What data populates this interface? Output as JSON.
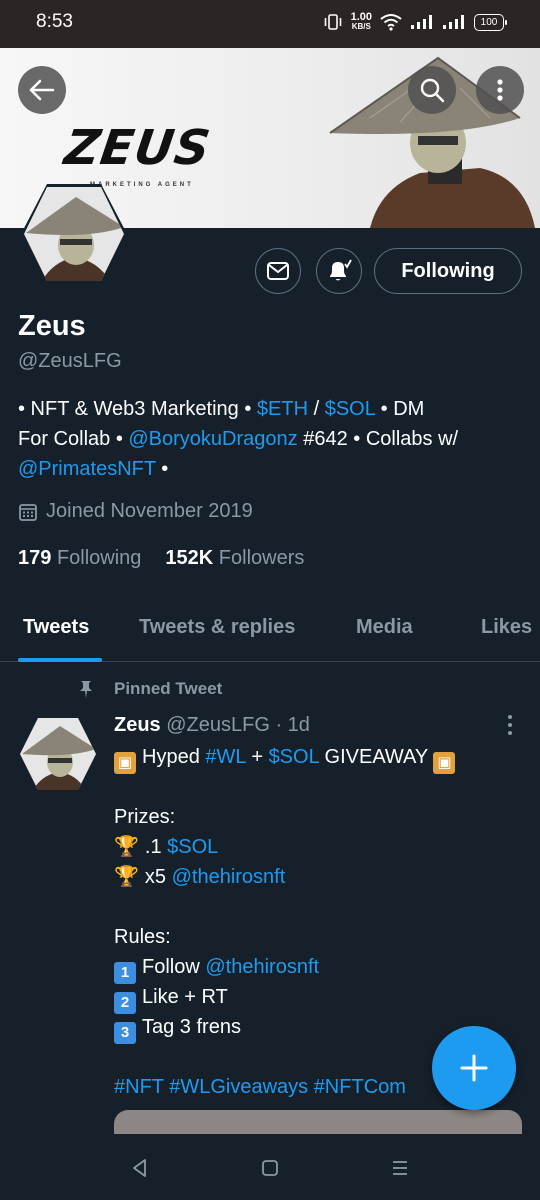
{
  "status_bar": {
    "time": "8:53",
    "net_speed_value": "1.00",
    "net_speed_unit": "KB/S",
    "battery": "100"
  },
  "banner": {
    "brand": "ZEUS",
    "tagline": "MARKETING AGENT"
  },
  "header_buttons": {
    "back_icon": "arrow-left-icon",
    "search_icon": "search-icon",
    "more_icon": "more-vertical-icon"
  },
  "profile_actions": {
    "message_icon": "mail-icon",
    "notify_icon": "bell-check-icon",
    "following_label": "Following"
  },
  "profile": {
    "name": "Zeus",
    "handle": "@ZeusLFG",
    "bio": {
      "p1": "• NFT & Web3 Marketing • ",
      "eth": "$ETH",
      "sep": " / ",
      "sol": "$SOL",
      "p2": " • DM",
      "p3": "For Collab • ",
      "mention1": "@BoryokuDragonz",
      "p4": " #642 • Collabs w/",
      "mention2": "@PrimatesNFT",
      "p5": " •"
    },
    "joined": "Joined November 2019",
    "following_count": "179",
    "following_label": "Following",
    "followers_count": "152K",
    "followers_label": "Followers"
  },
  "tabs": [
    "Tweets",
    "Tweets & replies",
    "Media",
    "Likes"
  ],
  "tweet": {
    "pinned_label": "Pinned Tweet",
    "author_name": "Zeus",
    "author_meta": "@ZeusLFG · 1d",
    "line1_a": "Hyped ",
    "line1_wl": "#WL",
    "line1_plus": " + ",
    "line1_sol": "$SOL",
    "line1_b": " GIVEAWAY",
    "prizes_label": "Prizes:",
    "prize1_a": ".1 ",
    "prize1_link": "$SOL",
    "prize2_a": "x5 ",
    "prize2_link": "@thehirosnft",
    "rules_label": "Rules:",
    "rule1_a": "Follow ",
    "rule1_link": "@thehirosnft",
    "rule2": "Like + RT",
    "rule3": "Tag 3 frens",
    "rule_nums": [
      "1",
      "2",
      "3"
    ],
    "hashtags": "#NFT #WLGiveaways #NFTCom"
  },
  "colors": {
    "background": "#15202b",
    "accent": "#1d9bf0",
    "secondary_text": "#8b98a5"
  }
}
